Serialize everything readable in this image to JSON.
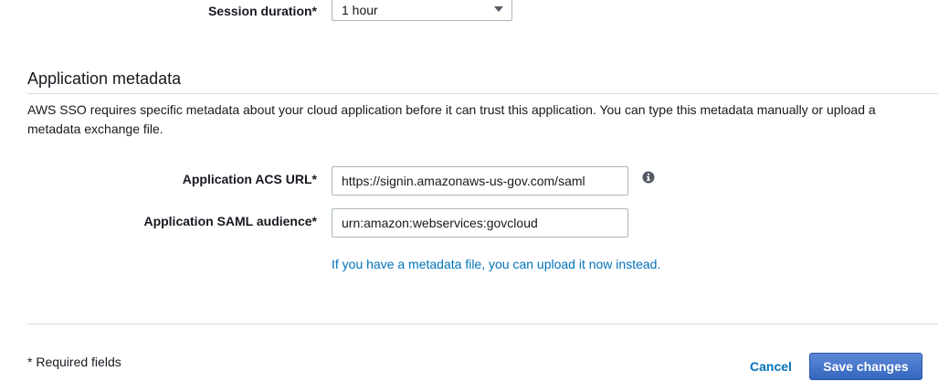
{
  "session": {
    "label": "Session duration*",
    "value": "1 hour"
  },
  "metadata": {
    "title": "Application metadata",
    "description": "AWS SSO requires specific metadata about your cloud application before it can trust this application. You can type this metadata manually or upload a metadata exchange file.",
    "acs_url": {
      "label": "Application ACS URL*",
      "value": "https://signin.amazonaws-us-gov.com/saml"
    },
    "saml_audience": {
      "label": "Application SAML audience*",
      "value": "urn:amazon:webservices:govcloud"
    },
    "upload_link": "If you have a metadata file, you can upload it now instead."
  },
  "footer": {
    "required_note": "* Required fields",
    "cancel_label": "Cancel",
    "save_label": "Save changes"
  },
  "colors": {
    "link": "#0073bb",
    "primary_button": "#3f6ec0",
    "border": "#aab7b8",
    "divider": "#d5dbdb"
  },
  "icons": {
    "info": "info-icon",
    "dropdown": "chevron-down-icon"
  }
}
